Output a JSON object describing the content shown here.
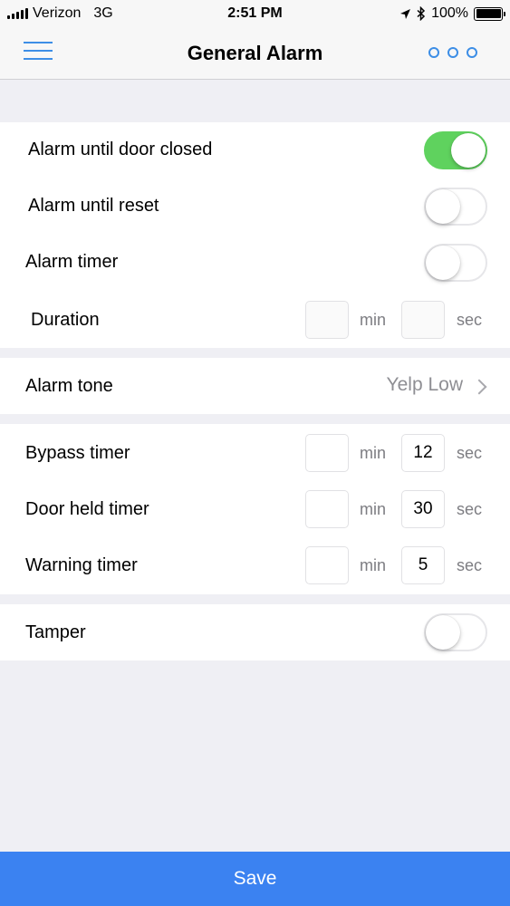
{
  "status_bar": {
    "carrier": "Verizon",
    "network": "3G",
    "time": "2:51 PM",
    "battery": "100%"
  },
  "nav": {
    "title": "General Alarm"
  },
  "alarm_options": {
    "until_door_closed": {
      "label": "Alarm until door closed",
      "enabled": true
    },
    "until_reset": {
      "label": "Alarm until reset",
      "enabled": false
    },
    "timer": {
      "label": "Alarm timer",
      "enabled": false
    },
    "duration": {
      "label": "Duration",
      "min": "",
      "sec": "",
      "min_unit": "min",
      "sec_unit": "sec"
    }
  },
  "alarm_tone": {
    "label": "Alarm tone",
    "value": "Yelp Low"
  },
  "timers": {
    "bypass": {
      "label": "Bypass timer",
      "min": "",
      "sec": "12",
      "min_unit": "min",
      "sec_unit": "sec"
    },
    "door_held": {
      "label": "Door held timer",
      "min": "",
      "sec": "30",
      "min_unit": "min",
      "sec_unit": "sec"
    },
    "warning": {
      "label": "Warning timer",
      "min": "",
      "sec": "5",
      "min_unit": "min",
      "sec_unit": "sec"
    }
  },
  "tamper": {
    "label": "Tamper",
    "enabled": false
  },
  "save_label": "Save",
  "colors": {
    "accent": "#3d8ee6",
    "toggle_on": "#5fd25e",
    "save_bar": "#3b82f1",
    "background": "#efeff4"
  }
}
